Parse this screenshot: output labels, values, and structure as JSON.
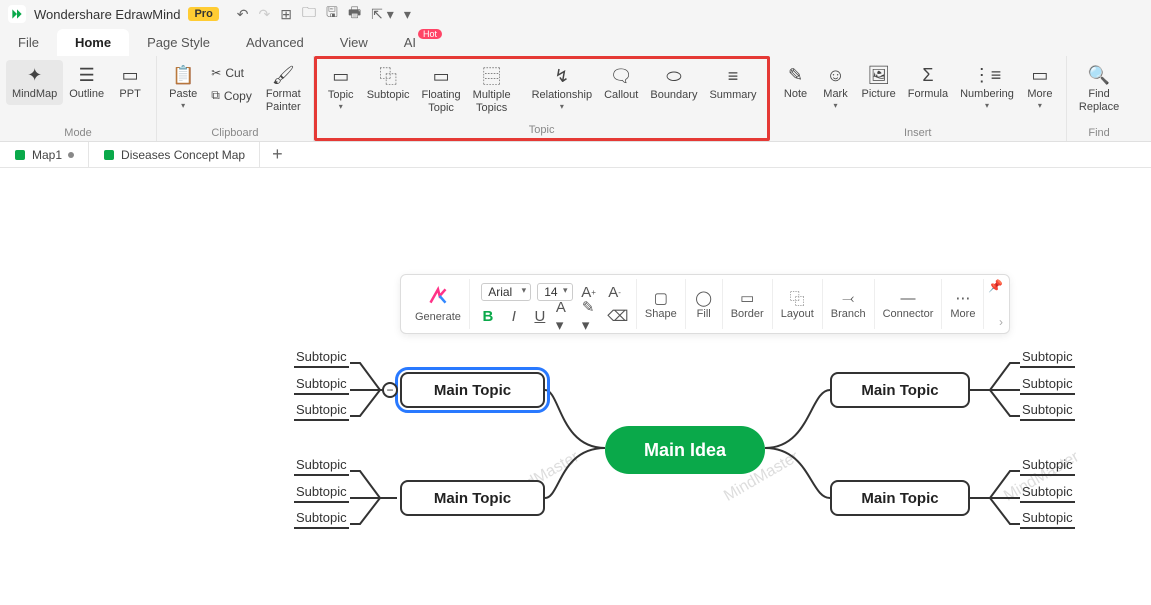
{
  "titlebar": {
    "app_name": "Wondershare EdrawMind",
    "pro": "Pro"
  },
  "menubar": {
    "file": "File",
    "home": "Home",
    "page_style": "Page Style",
    "advanced": "Advanced",
    "view": "View",
    "ai": "AI",
    "hot": "Hot"
  },
  "ribbon": {
    "mode": {
      "label": "Mode",
      "mindmap": "MindMap",
      "outline": "Outline",
      "ppt": "PPT"
    },
    "clipboard": {
      "label": "Clipboard",
      "paste": "Paste",
      "cut": "Cut",
      "copy": "Copy",
      "format_painter": "Format\nPainter"
    },
    "topic_group": {
      "label": "Topic",
      "topic": "Topic",
      "subtopic": "Subtopic",
      "floating": "Floating\nTopic",
      "multiple": "Multiple\nTopics",
      "relationship": "Relationship",
      "callout": "Callout",
      "boundary": "Boundary",
      "summary": "Summary"
    },
    "insert": {
      "label": "Insert",
      "note": "Note",
      "mark": "Mark",
      "picture": "Picture",
      "formula": "Formula",
      "numbering": "Numbering",
      "more": "More"
    },
    "find": {
      "label": "Find",
      "find_replace": "Find\nReplace"
    }
  },
  "tabs": {
    "tab1": "Map1",
    "tab2": "Diseases Concept Map"
  },
  "float_toolbar": {
    "generate": "Generate",
    "font": "Arial",
    "size": "14",
    "shape": "Shape",
    "fill": "Fill",
    "border": "Border",
    "layout": "Layout",
    "branch": "Branch",
    "connector": "Connector",
    "more": "More"
  },
  "mindmap": {
    "main_idea": "Main Idea",
    "main_topic": "Main Topic",
    "subtopic": "Subtopic",
    "watermark": "MindMaster"
  }
}
